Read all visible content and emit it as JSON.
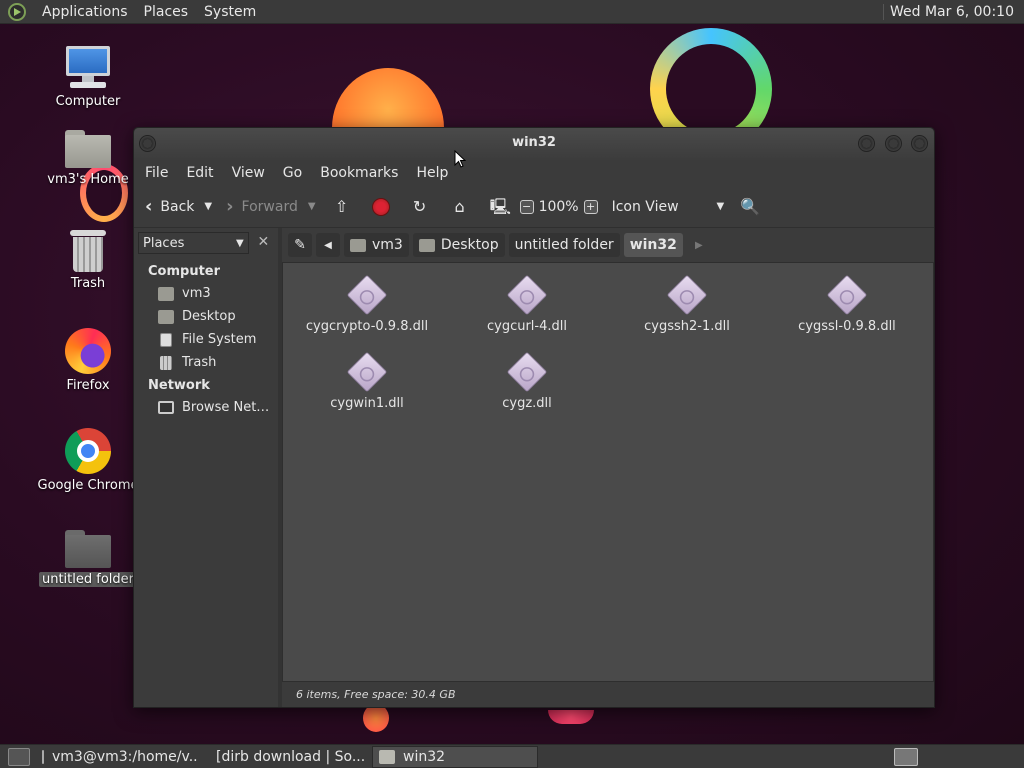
{
  "top_panel": {
    "menu": [
      "Applications",
      "Places",
      "System"
    ],
    "clock": "Wed Mar  6, 00:10"
  },
  "desktop": {
    "icons": [
      {
        "label": "Computer",
        "icon": "computer-icon"
      },
      {
        "label": "vm3's Home",
        "icon": "home-folder-icon"
      },
      {
        "label": "Trash",
        "icon": "trash-icon"
      },
      {
        "label": "Firefox",
        "icon": "firefox-icon"
      },
      {
        "label": "Google Chrome",
        "icon": "chrome-icon"
      },
      {
        "label": "untitled folder",
        "icon": "folder-icon"
      }
    ]
  },
  "window": {
    "title": "win32",
    "menu": [
      "File",
      "Edit",
      "View",
      "Go",
      "Bookmarks",
      "Help"
    ],
    "toolbar": {
      "back": "Back",
      "forward": "Forward",
      "zoom": "100%",
      "view_mode": "Icon View"
    },
    "sidebar": {
      "selector": "Places",
      "close": "✕",
      "categories": [
        {
          "name": "Computer",
          "items": [
            "vm3",
            "Desktop",
            "File System",
            "Trash"
          ]
        },
        {
          "name": "Network",
          "items": [
            "Browse Net…"
          ]
        }
      ]
    },
    "path": [
      "vm3",
      "Desktop",
      "untitled folder",
      "win32"
    ],
    "files": [
      "cygcrypto-0.9.8.dll",
      "cygcurl-4.dll",
      "cygssh2-1.dll",
      "cygssl-0.9.8.dll",
      "cygwin1.dll",
      "cygz.dll"
    ],
    "status": "6 items, Free space: 30.4 GB"
  },
  "taskbar": {
    "tasks": [
      {
        "label": "vm3@vm3:/home/v...",
        "icon": "terminal-icon",
        "active": false
      },
      {
        "label": "[dirb download | So...",
        "icon": "firefox-icon",
        "active": false
      },
      {
        "label": "win32",
        "icon": "folder-icon",
        "active": true
      }
    ]
  },
  "colors": {
    "panel": "#3a3a3a",
    "window": "#3b3b3b",
    "icon_view": "#4a4a4a",
    "desktop": "#2a0d1f"
  }
}
